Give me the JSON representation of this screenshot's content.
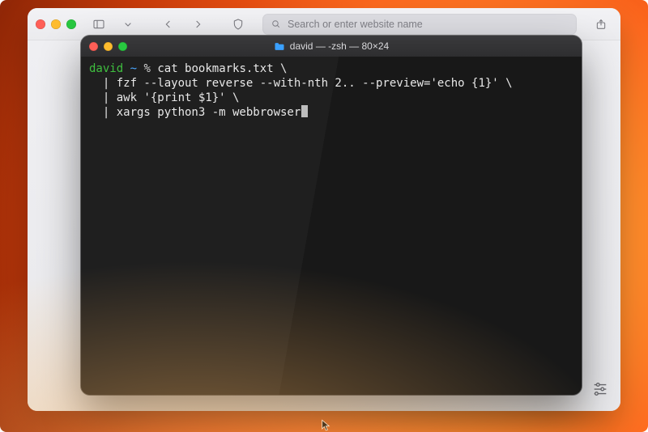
{
  "safari": {
    "search_placeholder": "Search or enter website name"
  },
  "terminal": {
    "title": "david — -zsh — 80×24",
    "prompt": {
      "user": "david",
      "path": "~",
      "symbol": "%"
    },
    "lines": [
      "cat bookmarks.txt \\",
      "| fzf --layout reverse --with-nth 2.. --preview='echo {1}' \\",
      "| awk '{print $1}' \\",
      "| xargs python3 -m webbrowser"
    ]
  }
}
